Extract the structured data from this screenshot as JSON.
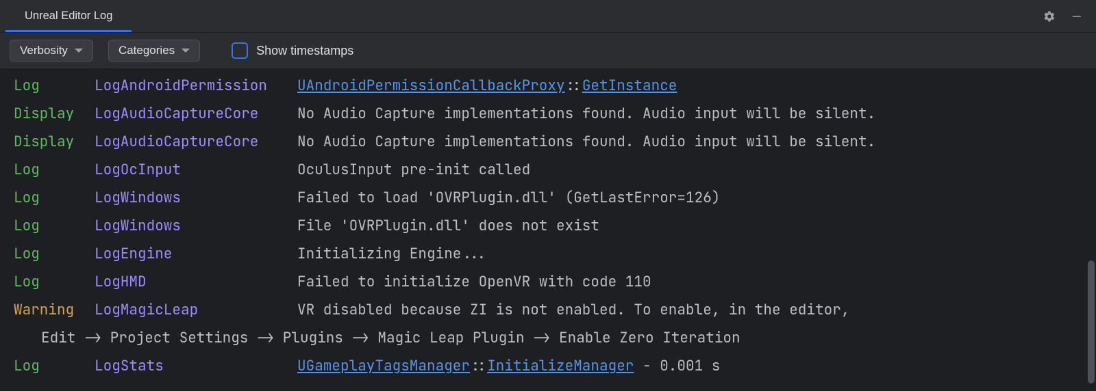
{
  "tab": {
    "title": "Unreal Editor Log"
  },
  "toolbar": {
    "verbosity_label": "Verbosity",
    "categories_label": "Categories",
    "show_timestamps_label": "Show timestamps"
  },
  "entries": [
    {
      "level": "Log",
      "level_class": "lvl-log",
      "category": "LogAndroidPermission",
      "type": "link2",
      "link1": "UAndroidPermissionCallbackProxy",
      "sep": "::",
      "link2": "GetInstance",
      "tail": ""
    },
    {
      "level": "Display",
      "level_class": "lvl-display",
      "category": "LogAudioCaptureCore",
      "type": "plain",
      "message": "No Audio Capture implementations found. Audio input will be silent."
    },
    {
      "level": "Display",
      "level_class": "lvl-display",
      "category": "LogAudioCaptureCore",
      "type": "plain",
      "message": "No Audio Capture implementations found. Audio input will be silent."
    },
    {
      "level": "Log",
      "level_class": "lvl-log",
      "category": "LogOcInput",
      "type": "plain",
      "message": "OculusInput pre-init called"
    },
    {
      "level": "Log",
      "level_class": "lvl-log",
      "category": "LogWindows",
      "type": "plain",
      "message": "Failed to load 'OVRPlugin.dll' (GetLastError=126)"
    },
    {
      "level": "Log",
      "level_class": "lvl-log",
      "category": "LogWindows",
      "type": "plain",
      "message": "File 'OVRPlugin.dll' does not exist"
    },
    {
      "level": "Log",
      "level_class": "lvl-log",
      "category": "LogEngine",
      "type": "plain",
      "message": "Initializing Engine..."
    },
    {
      "level": "Log",
      "level_class": "lvl-log",
      "category": "LogHMD",
      "type": "plain",
      "message": "Failed to initialize OpenVR with code 110"
    },
    {
      "level": "Warning",
      "level_class": "lvl-warning",
      "category": "LogMagicLeap",
      "type": "plain",
      "message": "VR disabled because ZI is not enabled.  To enable, in the editor,",
      "continuation": "Edit -> Project Settings -> Plugins -> Magic Leap Plugin -> Enable Zero Iteration"
    },
    {
      "level": "Log",
      "level_class": "lvl-log",
      "category": "LogStats",
      "type": "link2",
      "link1": "UGameplayTagsManager",
      "sep": "::",
      "link2": "InitializeManager",
      "tail": " -  0.001 s"
    }
  ]
}
